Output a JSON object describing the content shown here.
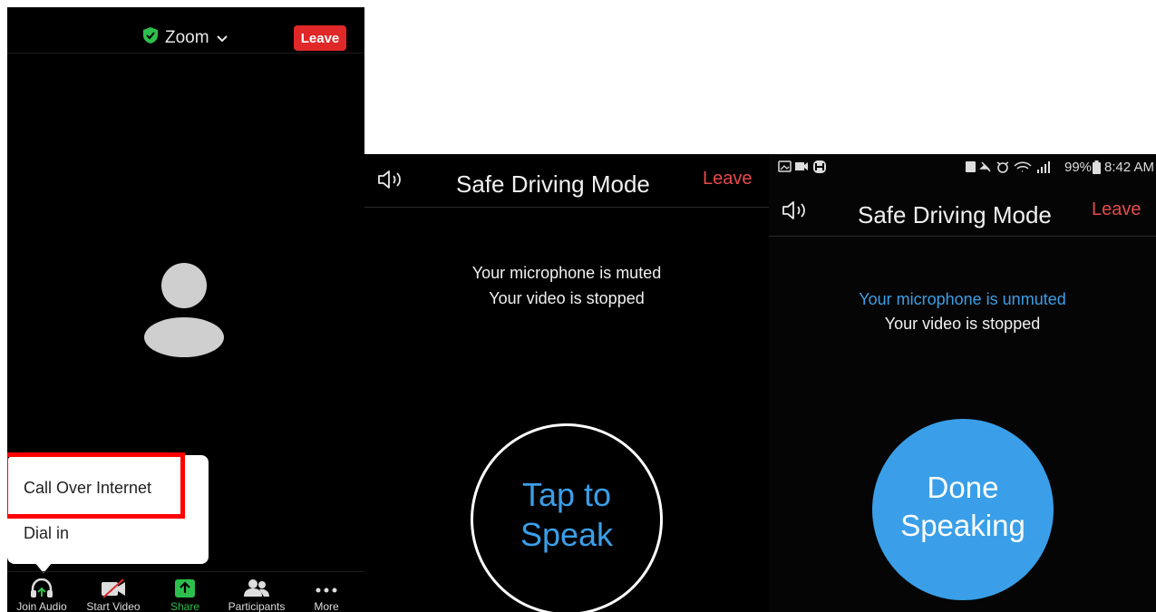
{
  "meeting": {
    "app_name": "Zoom",
    "leave_label": "Leave",
    "audio_menu": {
      "items": [
        "Call Over Internet",
        "Dial in"
      ]
    },
    "toolbar": [
      {
        "label": "Join Audio",
        "icon": "headphones-icon",
        "color": "#dddddd"
      },
      {
        "label": "Start Video",
        "icon": "video-off-icon",
        "color": "#dddddd"
      },
      {
        "label": "Share",
        "icon": "share-icon",
        "color": "#2dbf4d"
      },
      {
        "label": "Participants",
        "icon": "participants-icon",
        "color": "#dddddd"
      },
      {
        "label": "More",
        "icon": "more-icon",
        "color": "#dddddd"
      }
    ]
  },
  "driving_muted": {
    "title": "Safe Driving Mode",
    "leave_label": "Leave",
    "mic_status": "Your microphone is muted",
    "video_status": "Your video is stopped",
    "button_line1": "Tap to",
    "button_line2": "Speak"
  },
  "driving_unmuted": {
    "status_bar": {
      "battery": "99%",
      "time": "8:42 AM"
    },
    "title": "Safe Driving Mode",
    "leave_label": "Leave",
    "mic_status": "Your microphone is unmuted",
    "video_status": "Your video is stopped",
    "button_line1": "Done",
    "button_line2": "Speaking"
  },
  "colors": {
    "leave_red": "#e02828",
    "accent_blue": "#3a9fe8",
    "share_green": "#2dbf4d",
    "highlight_red": "#ff0000"
  }
}
